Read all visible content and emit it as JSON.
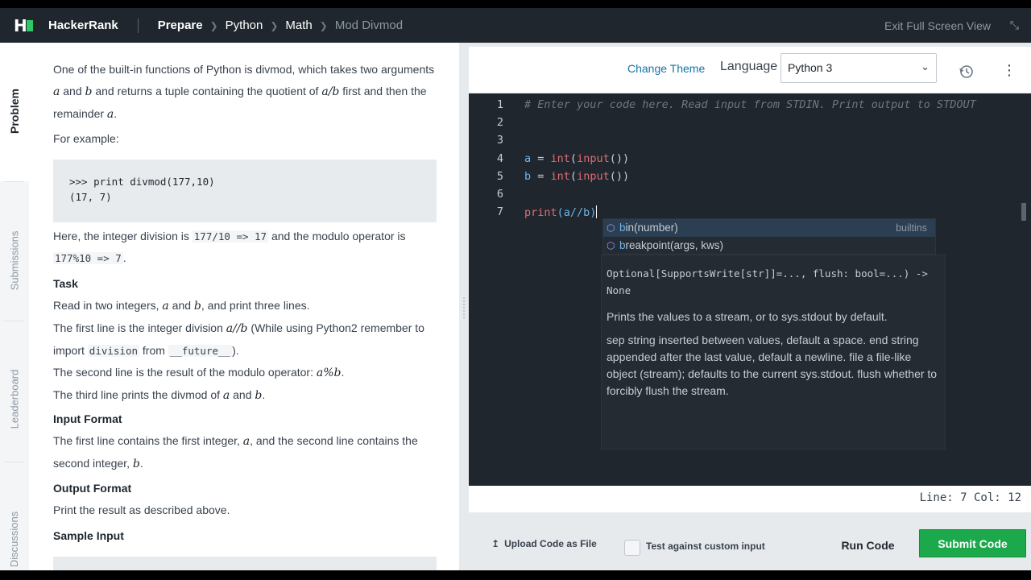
{
  "topbar": {
    "brand": "HackerRank",
    "breadcrumb": [
      "Prepare",
      "Python",
      "Math",
      "Mod Divmod"
    ],
    "exit_fullscreen": "Exit Full Screen View"
  },
  "side_tabs": [
    "Problem",
    "Submissions",
    "Leaderboard",
    "Discussions"
  ],
  "problem": {
    "intro": {
      "t1": "One of the built-in functions of Python is divmod, which takes two arguments ",
      "a1": "a",
      "t2": " and ",
      "b1": "b",
      "t3": " and returns a tuple containing the quotient of ",
      "ab": "a/b",
      "t4": " first and then the remainder ",
      "a2": "a",
      "t5": "."
    },
    "for_example": "For example:",
    "example_code": ">>> print divmod(177,10)\n(17, 7)",
    "here": {
      "t1": "Here, the integer division is ",
      "c1": "177/10 => 17",
      "t2": " and the modulo operator is ",
      "c2": "177%10 => 7",
      "t3": "."
    },
    "task_heading": "Task",
    "task_line1": {
      "t1": "Read in two integers, ",
      "a": "a",
      "t2": " and ",
      "b": "b",
      "t3": ", and print three lines."
    },
    "task_line2": {
      "t1": "The first line is the integer division ",
      "m": "a//b",
      "t2": " (While using Python2 remember to import ",
      "c1": "division",
      "t3": " from ",
      "c2": "__future__",
      "t4": ")."
    },
    "task_line3": {
      "t1": "The second line is the result of the modulo operator: ",
      "m": "a%b",
      "t2": "."
    },
    "task_line4": {
      "t1": "The third line prints the divmod of ",
      "a": "a",
      "t2": " and ",
      "b": "b",
      "t3": "."
    },
    "input_heading": "Input Format",
    "input_text": {
      "t1": "The first line contains the first integer, ",
      "a": "a",
      "t2": ", and the second line contains the second integer, ",
      "b": "b",
      "t3": "."
    },
    "output_heading": "Output Format",
    "output_text": "Print the result as described above.",
    "sample_heading": "Sample Input"
  },
  "editor": {
    "change_theme": "Change Theme",
    "language_label": "Language",
    "language_value": "Python 3",
    "line_numbers": [
      "1",
      "2",
      "3",
      "4",
      "5",
      "6",
      "7"
    ],
    "code": {
      "l1": "# Enter your code here. Read input from STDIN. Print output to STDOUT",
      "l4_var": "a",
      "l5_var": "b",
      "assign": " = ",
      "int_kw": "int",
      "input_kw": "input",
      "paren_open": "(",
      "paren_close": "())",
      "print_kw": "print",
      "l7_args": "(a//b)"
    },
    "suggestions": [
      {
        "hl": "b",
        "rest": "in(number)",
        "detail": "builtins"
      },
      {
        "hl": "b",
        "rest": "reakpoint(args, kws)",
        "detail": ""
      }
    ],
    "hover": {
      "signature": "Optional[SupportsWrite[str]]=..., flush: bool=...) -> None",
      "description": "Prints the values to a stream, or to sys.stdout by default.",
      "params": "sep   string inserted between values, default a space. end   string appended after the last value, default a newline. file   a file-like object (stream); defaults to the current sys.stdout. flush   whether to forcibly flush the stream."
    },
    "status": "Line: 7 Col: 12"
  },
  "actions": {
    "upload": "Upload Code as File",
    "custom_input": "Test against custom input",
    "run": "Run Code",
    "submit": "Submit Code"
  },
  "colors": {
    "topbar_bg": "#1f262d",
    "accent_green": "#1ba94c",
    "link_blue": "#1474a8",
    "editor_bg": "#1f262d"
  }
}
